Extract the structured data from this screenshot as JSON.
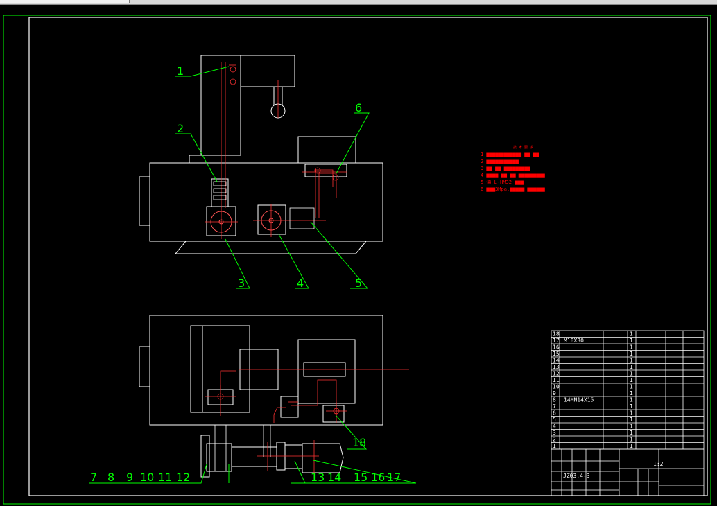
{
  "callouts_top": [
    "1",
    "2",
    "3",
    "4",
    "5",
    "6"
  ],
  "callouts_bottom": [
    "7",
    "8",
    "9",
    "10",
    "11",
    "12",
    "13",
    "14",
    "15",
    "16",
    "17",
    "18"
  ],
  "notes": {
    "title": "技 术 要 求",
    "items": [
      "1  ▆▆▆▆▆▆▆▆▆▆▆▆ ▆▆ ▆▆",
      "2  ▆▆▆▆▆▆▆▆▆▆▆",
      "3  ▆▆ ▆▆ ▆▆▆▆▆▆▆▆▆",
      "4  ▆▆▆▆ ▆▆ ▆▆ ▆▆▆▆▆▆▆▆▆",
      "5  油 L-HM32 ▆▆▆",
      "6  ▆▆▆3Mpa,▆▆▆▆▆ ▆▆▆▆▆▆"
    ]
  },
  "parts_list": {
    "row_numbers": [
      "18",
      "17",
      "16",
      "15",
      "14",
      "13",
      "12",
      "11",
      "10",
      "9",
      "8",
      "7",
      "6",
      "5",
      "4",
      "3",
      "2",
      "1"
    ],
    "specs": [
      "",
      "M10X30",
      "",
      "",
      "",
      "",
      "",
      "",
      "",
      "",
      "14MN14X15",
      "",
      "",
      "",
      "",
      "",
      "",
      ""
    ],
    "quantities": [
      "1",
      "1",
      "1",
      "1",
      "1",
      "1",
      "1",
      "1",
      "1",
      "1",
      "1",
      "1",
      "1",
      "1",
      "1",
      "1",
      "1",
      "1"
    ],
    "drawing_number": "JZ03.4-3",
    "scale": "1:2"
  }
}
